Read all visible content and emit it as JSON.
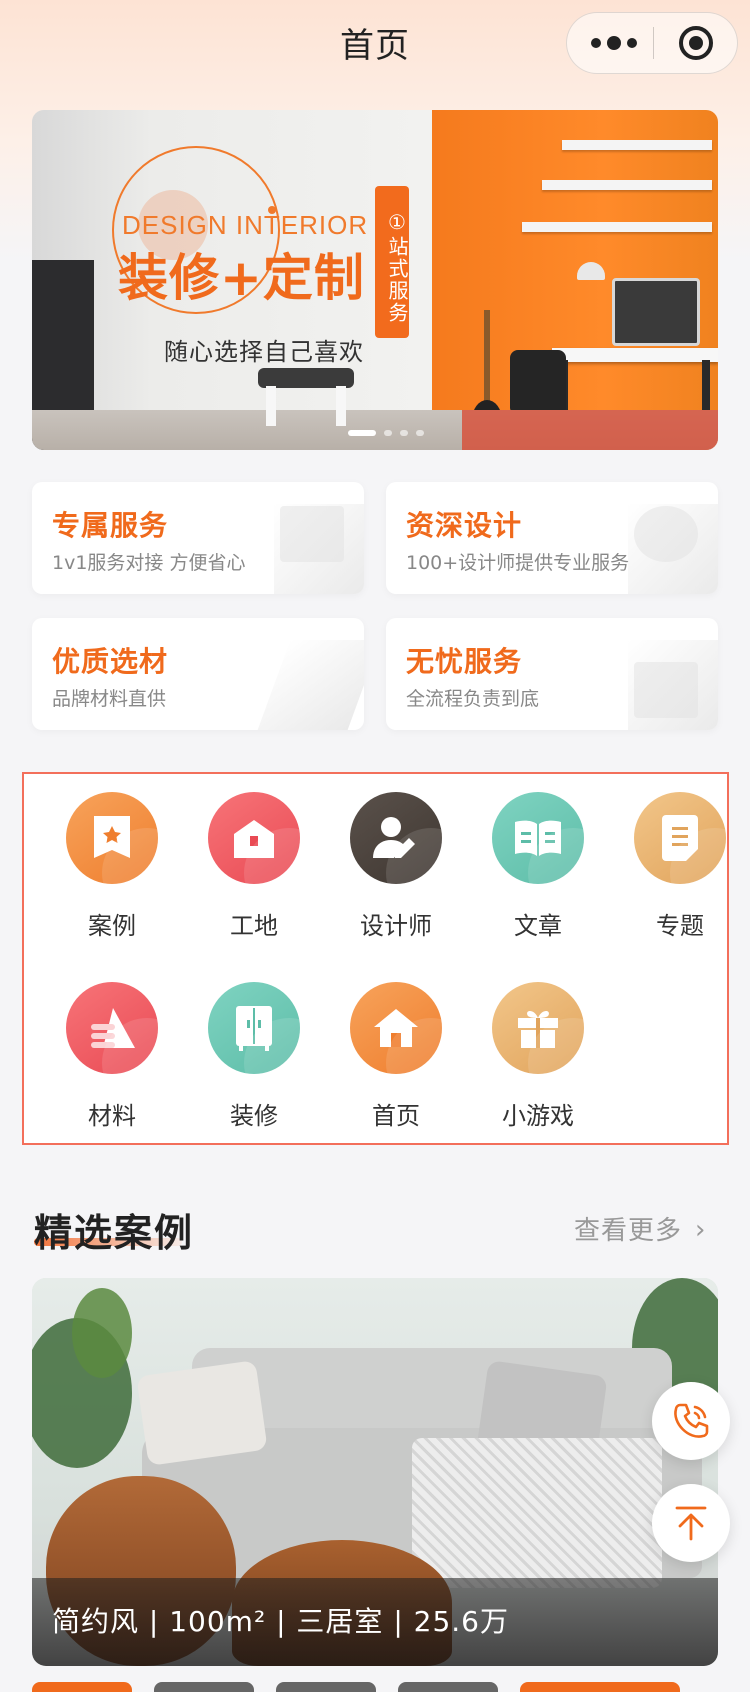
{
  "navbar": {
    "title": "首页",
    "menu_icon": "more-dots-icon",
    "close_icon": "target-close-icon"
  },
  "banner": {
    "en_text": "DESIGN INTERIOR",
    "title": "装修+定制",
    "subtitle": "随心选择自己喜欢",
    "tag": "①站式服务",
    "active_dot": 0,
    "dot_count": 4
  },
  "features": [
    {
      "title": "专属服务",
      "desc": "1v1服务对接 方便省心"
    },
    {
      "title": "资深设计",
      "desc": "100+设计师提供专业服务"
    },
    {
      "title": "优质选材",
      "desc": "品牌材料直供"
    },
    {
      "title": "无忧服务",
      "desc": "全流程负责到底"
    }
  ],
  "grid": [
    {
      "label": "案例",
      "icon": "case-bookmark-icon",
      "color": "orange"
    },
    {
      "label": "工地",
      "icon": "site-house-icon",
      "color": "red"
    },
    {
      "label": "设计师",
      "icon": "designer-person-icon",
      "color": "dark"
    },
    {
      "label": "文章",
      "icon": "article-book-icon",
      "color": "teal"
    },
    {
      "label": "专题",
      "icon": "topic-note-icon",
      "color": "gold"
    },
    {
      "label": "材料",
      "icon": "material-stack-icon",
      "color": "red"
    },
    {
      "label": "装修",
      "icon": "renovation-wardrobe-icon",
      "color": "teal"
    },
    {
      "label": "首页",
      "icon": "home-icon",
      "color": "orange"
    },
    {
      "label": "小游戏",
      "icon": "game-gift-icon",
      "color": "gold"
    }
  ],
  "section": {
    "title": "精选案例",
    "more": "查看更多",
    "more_icon": "chevron-right-icon"
  },
  "case": {
    "caption": "简约风 | 100m² | 三居室 | 25.6万"
  },
  "fabs": {
    "phone_icon": "phone-icon",
    "top_icon": "back-to-top-icon"
  },
  "colors": {
    "accent": "#f06a1c",
    "highlight_border": "#f36f5b"
  }
}
